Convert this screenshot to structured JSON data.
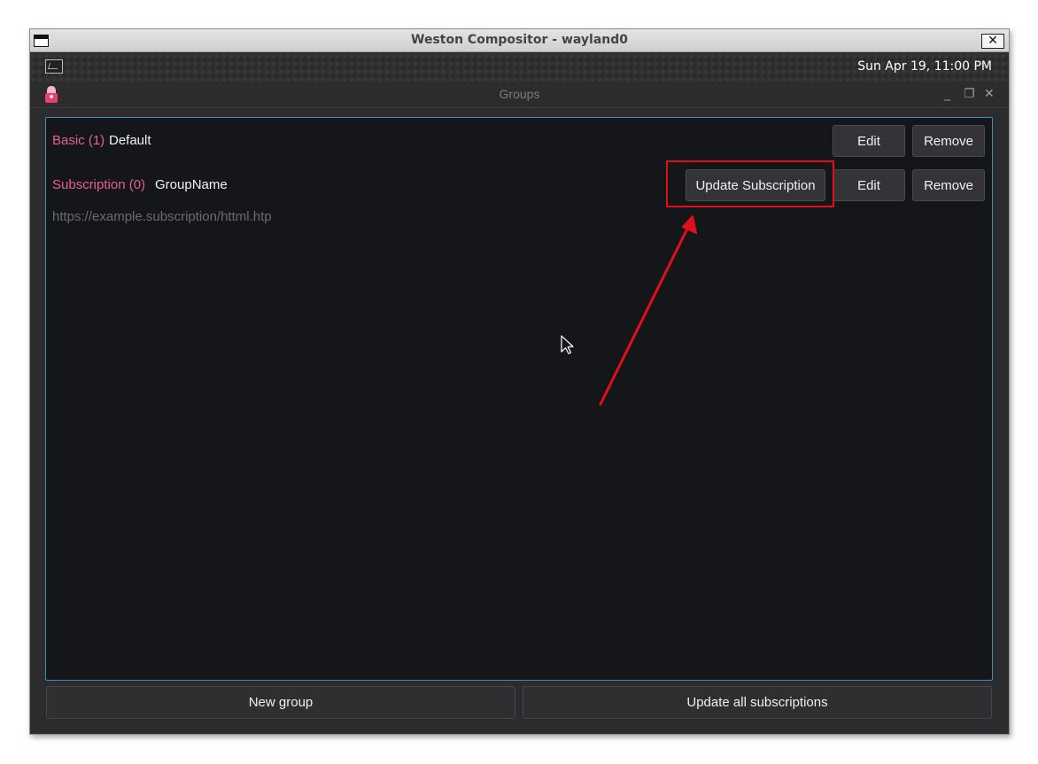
{
  "window": {
    "title": "Weston Compositor - wayland0",
    "close_glyph": "✕"
  },
  "panel": {
    "terminal_icon": "terminal-icon",
    "clock": "Sun Apr 19, 11:00 PM"
  },
  "app": {
    "title": "Groups",
    "icon": "app-icon",
    "controls": {
      "minimize": "_",
      "maximize": "❐",
      "close": "✕"
    }
  },
  "groups": [
    {
      "type_label": "Basic (1)",
      "name": "Default",
      "edit_label": "Edit",
      "remove_label": "Remove"
    },
    {
      "type_label": "Subscription (0)",
      "name": "GroupName",
      "url": "https://example.subscription/httml.htp",
      "update_label": "Update Subscription",
      "edit_label": "Edit",
      "remove_label": "Remove"
    }
  ],
  "footer": {
    "new_group_label": "New group",
    "update_all_label": "Update all subscriptions"
  },
  "colors": {
    "accent_pink": "#e6608e",
    "list_border": "#3d8fb3",
    "annotation_red": "#e0101a"
  }
}
